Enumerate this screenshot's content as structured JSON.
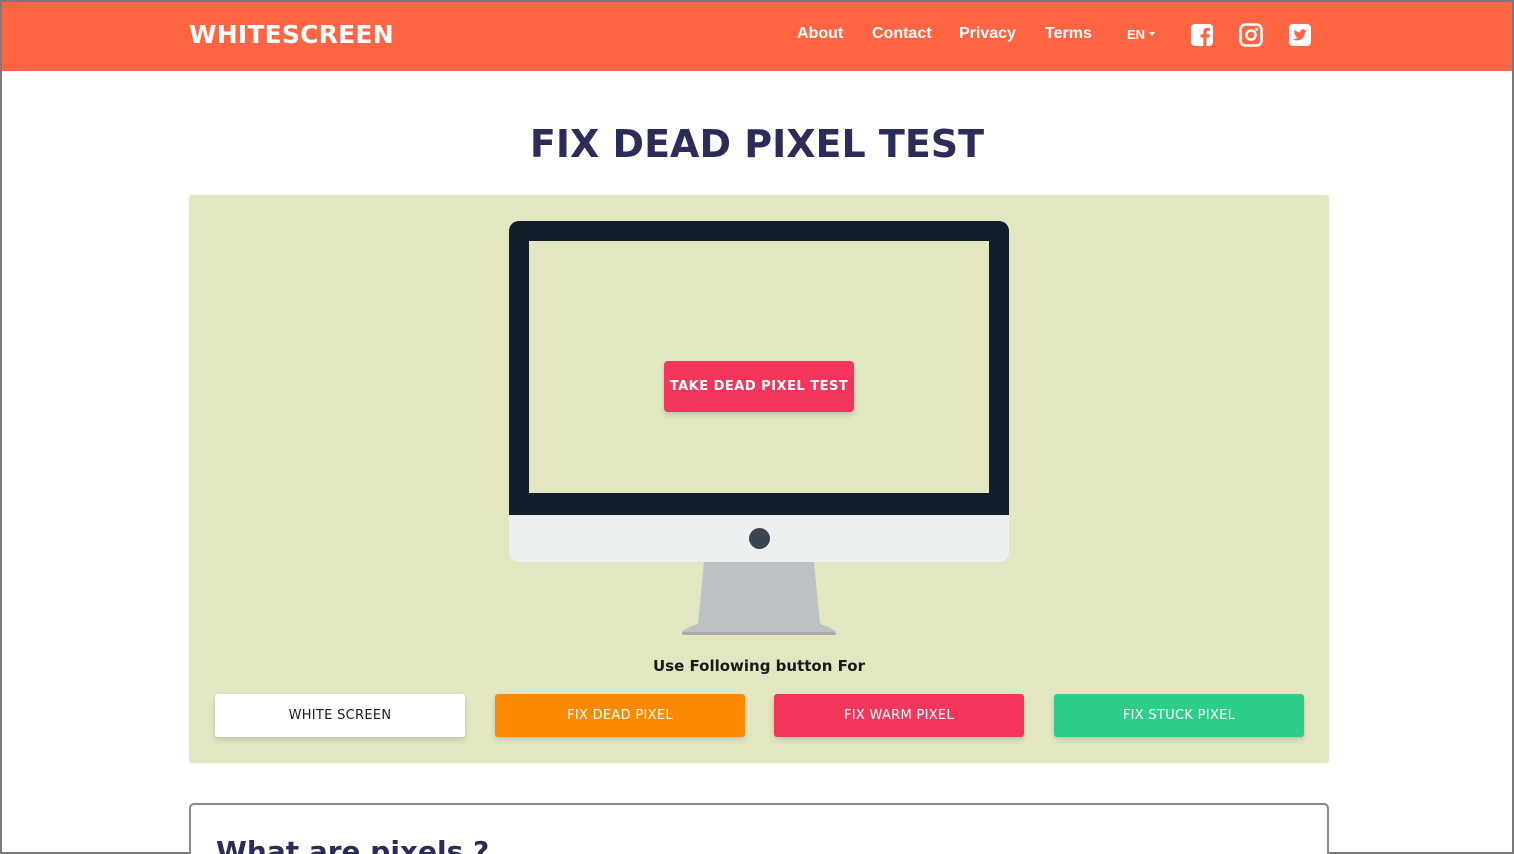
{
  "brand": "WHITESCREEN",
  "nav": {
    "links": [
      "About",
      "Contact",
      "Privacy",
      "Terms"
    ],
    "language": "EN",
    "social_icons": [
      "facebook-icon",
      "instagram-icon",
      "twitter-icon"
    ]
  },
  "page_title": "FIX DEAD PIXEL TEST",
  "hero": {
    "take_test_label": "TAKE DEAD PIXEL TEST",
    "subcaption": "Use Following button For",
    "buttons": [
      "WHITE SCREEN",
      "FIX DEAD PIXEL",
      "FIX WARM PIXEL",
      "FIX STUCK PIXEL"
    ]
  },
  "info_section": {
    "heading": "What are pixels ?"
  },
  "colors": {
    "navbar": "#ff6542",
    "hero_bg": "#e2e6c1",
    "title": "#2d2b58",
    "pink": "#f5365c",
    "orange": "#fb8a00",
    "green": "#2dce89"
  }
}
